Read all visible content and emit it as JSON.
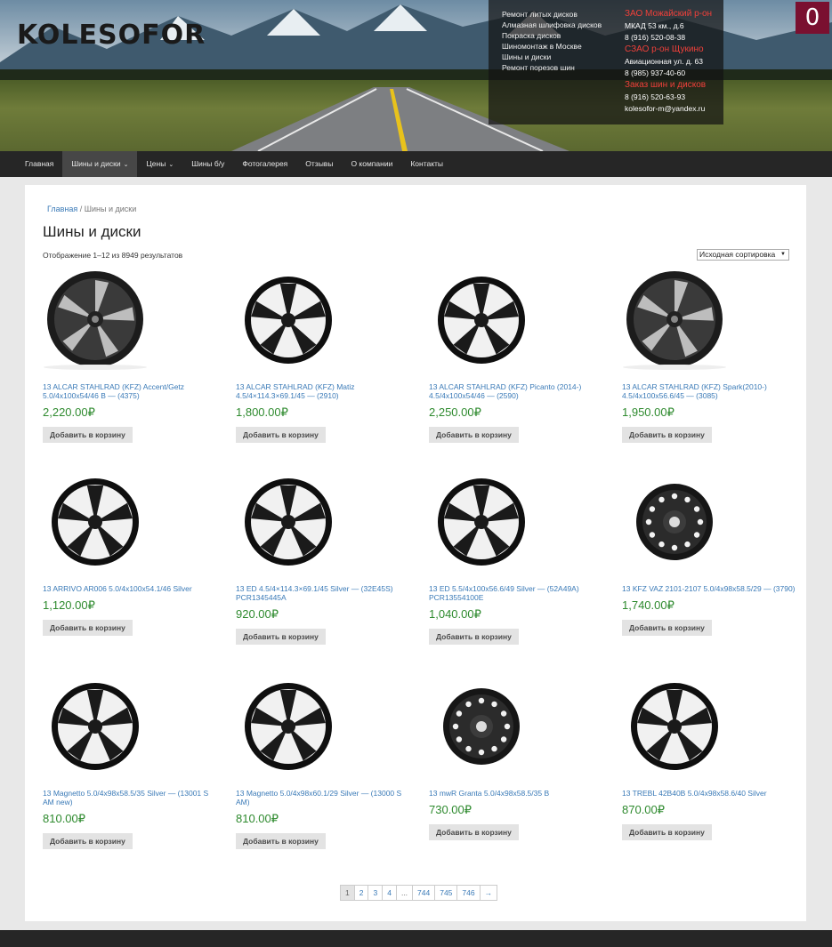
{
  "header": {
    "brand": "KOLESOFOR",
    "services": [
      "Ремонт литых дисков",
      "Алмазная шлифовка дисков",
      "Покраска дисков",
      "Шиномонтаж в Москве",
      "Шины и диски",
      "Ремонт порезов шин"
    ],
    "contacts": {
      "loc1_title": "ЗАО Можайский р-он",
      "loc1_addr": "МКАД 53 км., д.6",
      "loc1_phone": "8 (916) 520-08-38",
      "loc2_title": "СЗАО р-он Щукино",
      "loc2_addr": "Авиационная ул. д. 63",
      "loc2_phone": "8 (985) 937-40-60",
      "order_title": "Заказ шин и дисков",
      "order_phone": "8 (916) 520-63-93",
      "order_email": "kolesofor-m@yandex.ru"
    },
    "cart_count": "0"
  },
  "nav": [
    {
      "label": "Главная"
    },
    {
      "label": "Шины и диски",
      "caret": "⌄"
    },
    {
      "label": "Цены",
      "caret": "⌄"
    },
    {
      "label": "Шины б/у"
    },
    {
      "label": "Фотогалерея"
    },
    {
      "label": "Отзывы"
    },
    {
      "label": "О компании"
    },
    {
      "label": "Контакты"
    }
  ],
  "breadcrumb": {
    "home": "Главная",
    "sep": " / ",
    "current": "Шины и диски"
  },
  "page_title": "Шины и диски",
  "result_count": "Отображение 1–12 из 8949 результатов",
  "sort": {
    "selected": "Исходная сортировка",
    "arrow": "▼"
  },
  "add_to_cart_label": "Добавить в корзину",
  "products": [
    {
      "name": "13 ALCAR STAHLRAD (KFZ) Accent/Getz 5.0/4x100x54/46 B — (4375)",
      "price": "2,220.00₽",
      "wheel": "dish"
    },
    {
      "name": "13 ALCAR STAHLRAD (KFZ) Matiz 4.5/4×114.3×69.1/45 — (2910)",
      "price": "1,800.00₽",
      "wheel": "spoke"
    },
    {
      "name": "13 ALCAR STAHLRAD (KFZ) Picanto (2014-) 4.5/4x100x54/46 — (2590)",
      "price": "2,250.00₽",
      "wheel": "spoke"
    },
    {
      "name": "13 ALCAR STAHLRAD (KFZ) Spark(2010-) 4.5/4x100x56.6/45 — (3085)",
      "price": "1,950.00₽",
      "wheel": "dish"
    },
    {
      "name": "13 ARRIVO AR006 5.0/4x100x54.1/46 Silver",
      "price": "1,120.00₽",
      "wheel": "spoke"
    },
    {
      "name": "13 ED 4.5/4×114.3×69.1/45 Silver — (32E45S) PCR1345445A",
      "price": "920.00₽",
      "wheel": "spoke"
    },
    {
      "name": "13 ED 5.5/4x100x56.6/49 Silver — (52A49A) PCR13554100E",
      "price": "1,040.00₽",
      "wheel": "spoke"
    },
    {
      "name": "13 KFZ VAZ 2101-2107 5.0/4x98x58.5/29 — (3790)",
      "price": "1,740.00₽",
      "wheel": "steel"
    },
    {
      "name": "13 Magnetto 5.0/4x98x58.5/35 Silver — (13001 S AM new)",
      "price": "810.00₽",
      "wheel": "spoke"
    },
    {
      "name": "13 Magnetto 5.0/4x98x60.1/29 Silver — (13000 S AM)",
      "price": "810.00₽",
      "wheel": "spoke"
    },
    {
      "name": "13 mwR Granta 5.0/4x98x58.5/35 B",
      "price": "730.00₽",
      "wheel": "steel"
    },
    {
      "name": "13 TREBL 42B40B 5.0/4x98x58.6/40 Silver",
      "price": "870.00₽",
      "wheel": "spoke"
    }
  ],
  "pagination": [
    "1",
    "2",
    "3",
    "4",
    "...",
    "744",
    "745",
    "746",
    "→"
  ],
  "colors": {
    "link": "#3a7ab7",
    "price": "#2e8a2e",
    "nav_bg": "#262626",
    "accent_red": "#f0403a"
  }
}
